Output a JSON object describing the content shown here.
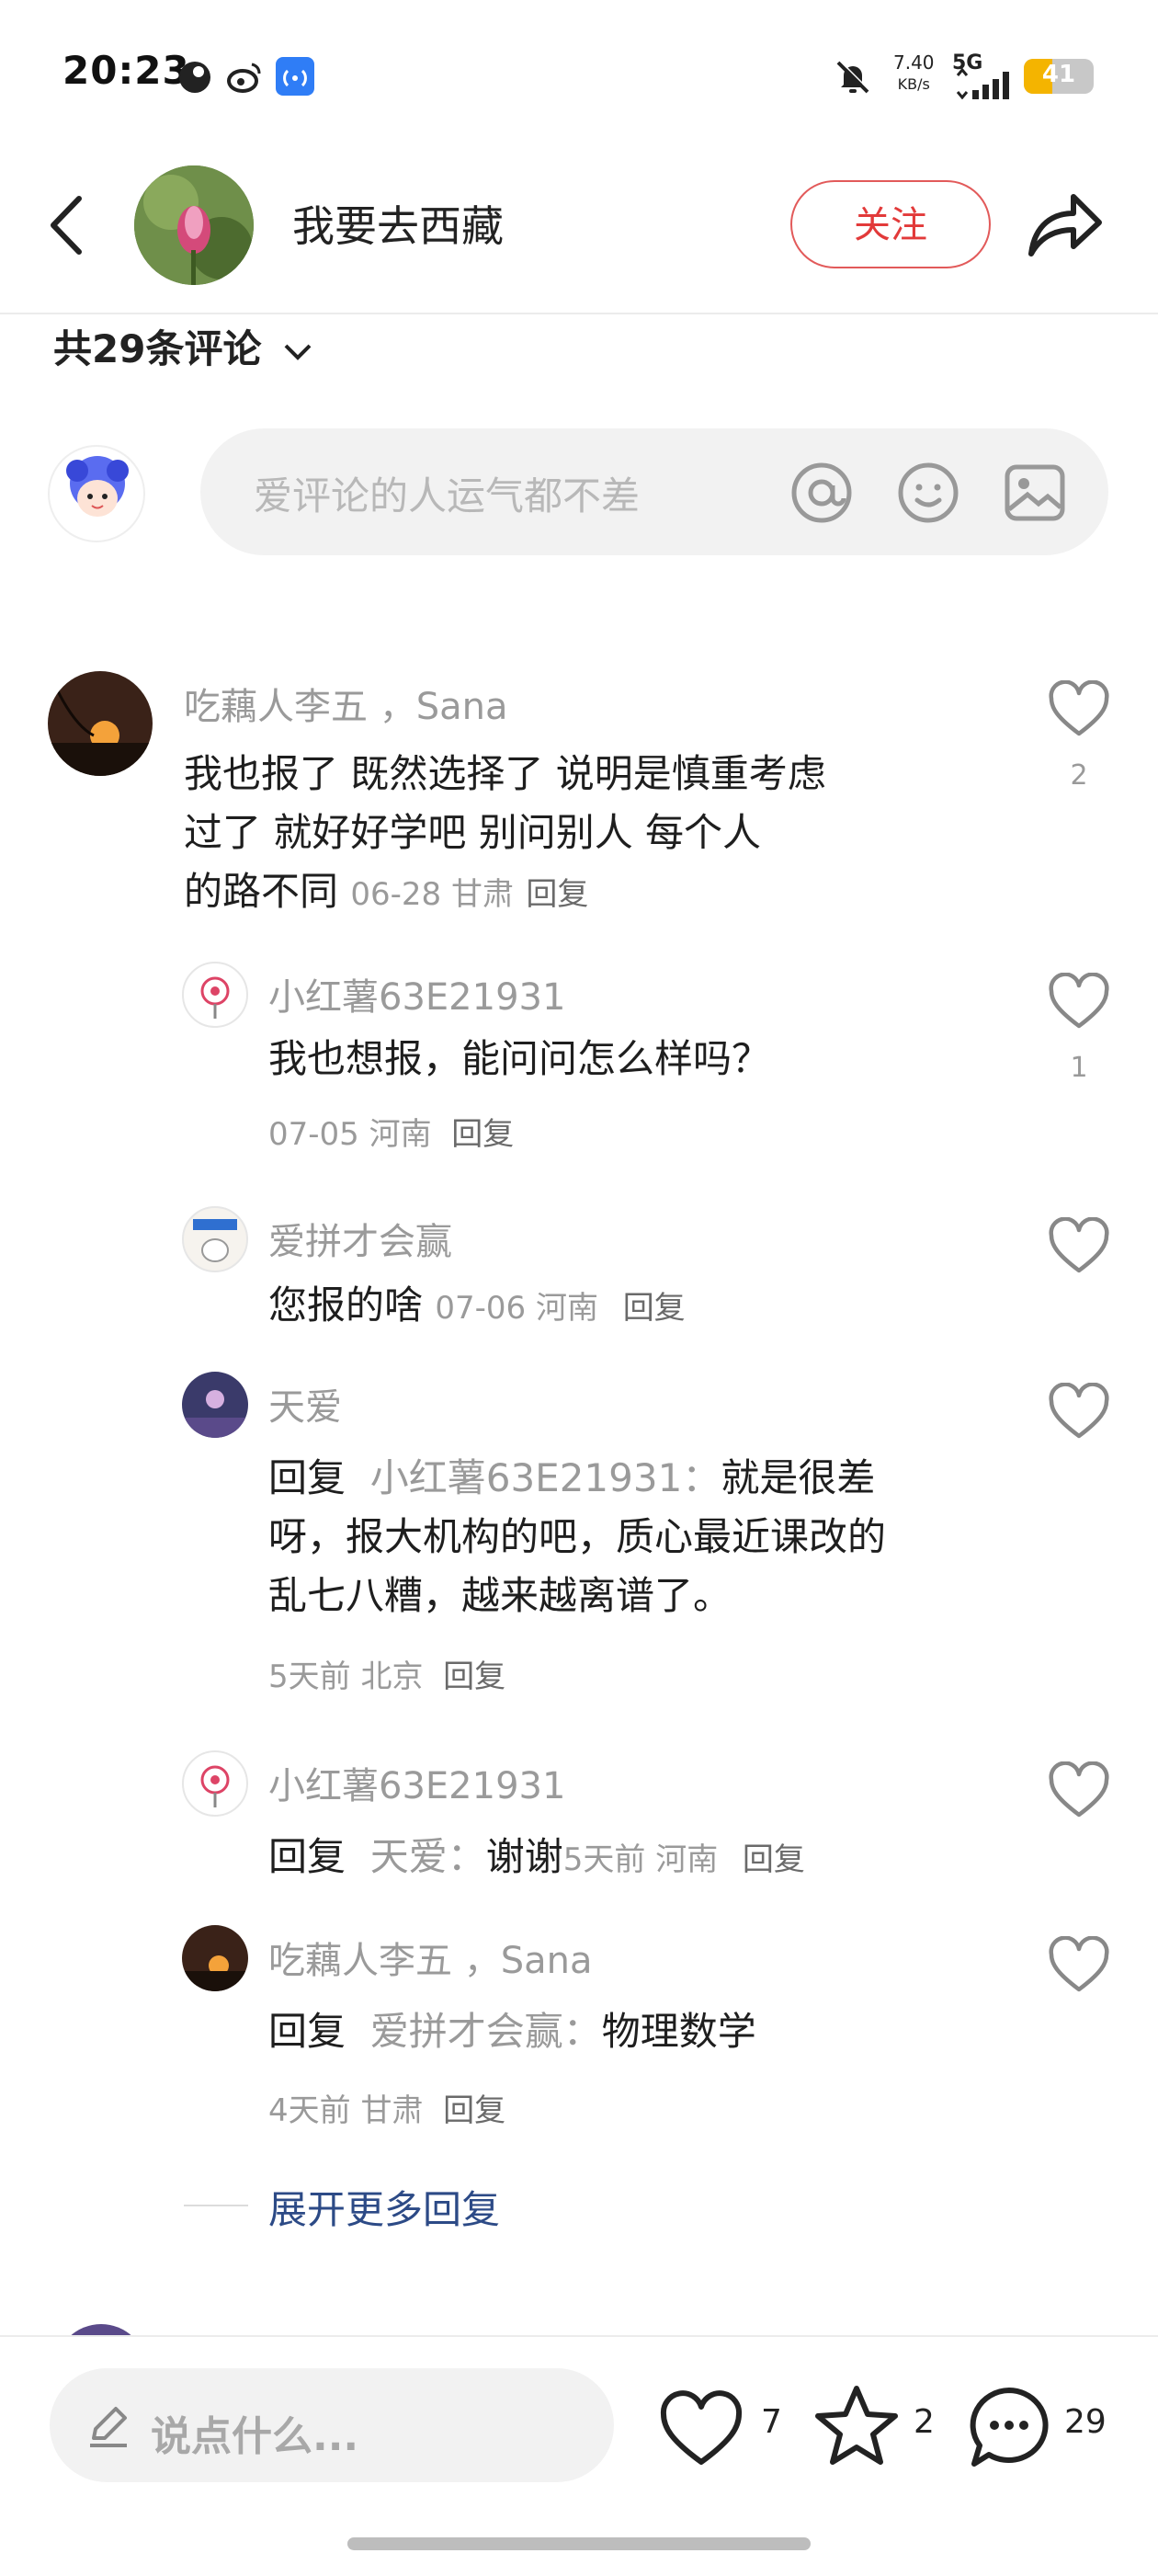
{
  "status_bar": {
    "time": "20:23",
    "network_speed_value": "7.40",
    "network_speed_unit": "KB/s",
    "network_type": "5G",
    "battery_level": "41",
    "icons": [
      "app-notification-icon",
      "weibo-icon",
      "broadcast-icon",
      "mute-icon",
      "signal-icon",
      "battery-icon"
    ]
  },
  "header": {
    "title": "我要去西藏",
    "follow_label": "关注",
    "icons": [
      "back-icon",
      "share-icon"
    ]
  },
  "comments_count_label": "共29条评论",
  "comment_input": {
    "placeholder": "爱评论的人运气都不差"
  },
  "comments": [
    {
      "user": "吃藕人李五 ，Sana",
      "text_lines": [
        "我也报了  既然选择了  说明是慎重考虑",
        "过了   就好好学吧   别问别人   每个人",
        "的路不同"
      ],
      "meta": "06-28 甘肃",
      "reply_label": "回复",
      "likes": "2",
      "replies": [
        {
          "user": "小红薯63E21931",
          "text": "我也想报，能问问怎么样吗？",
          "meta": "07-05 河南",
          "reply_label": "回复",
          "likes": "1"
        },
        {
          "user": "爱拼才会赢",
          "text": "您报的啥",
          "meta": "07-06 河南",
          "reply_label": "回复",
          "likes": ""
        },
        {
          "user": "天爱",
          "reply_prefix": "回复",
          "reply_to": "小红薯63E21931：",
          "text_lines": [
            "就是很差",
            "呀，报大机构的吧，质心最近课改的",
            "乱七八糟，越来越离谱了。"
          ],
          "meta": "5天前 北京",
          "reply_label": "回复",
          "likes": ""
        },
        {
          "user": "小红薯63E21931",
          "reply_prefix": "回复",
          "reply_to": "天爱：",
          "text": "谢谢",
          "meta": "5天前 河南",
          "reply_label": "回复",
          "likes": ""
        },
        {
          "user": "吃藕人李五 ，Sana",
          "reply_prefix": "回复",
          "reply_to": "爱拼才会赢：",
          "text": "物理数学",
          "meta": "4天前 甘肃",
          "reply_label": "回复",
          "likes": ""
        }
      ],
      "expand_label": "展开更多回复"
    }
  ],
  "bottom_bar": {
    "say_placeholder": "说点什么...",
    "likes": "7",
    "favorites": "2",
    "comments": "29"
  },
  "colors": {
    "accent_red": "#e23a3a",
    "expand_link": "#2c4a86",
    "muted_text": "#9a9a9a",
    "input_bg": "#f2f2f2"
  }
}
